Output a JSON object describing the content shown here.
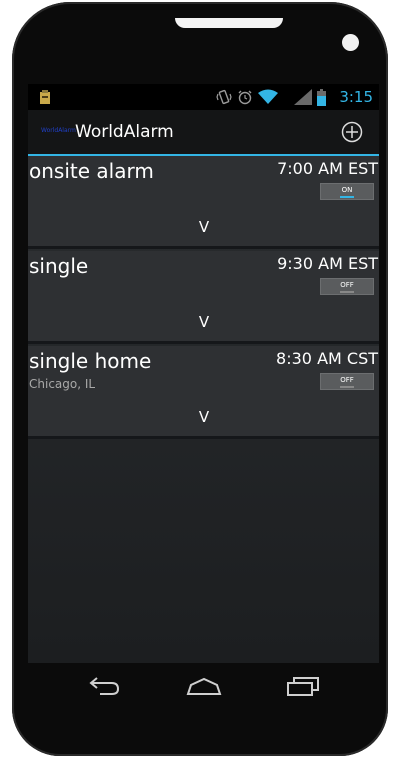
{
  "statusbar": {
    "time": "3:15",
    "icons": [
      "notification-icon",
      "vibrate-icon",
      "alarm-icon",
      "wifi-icon",
      "signal-icon",
      "battery-icon"
    ]
  },
  "actionbar": {
    "app_icon_text": "WorldAlarm",
    "title": "WorldAlarm",
    "add_icon": "plus-circle-icon"
  },
  "alarms": [
    {
      "name": "onsite alarm",
      "location": "",
      "time": "7:00 AM EST",
      "toggle": "ON",
      "expand": "V"
    },
    {
      "name": "single",
      "location": "",
      "time": "9:30 AM EST",
      "toggle": "OFF",
      "expand": "V"
    },
    {
      "name": "single home",
      "location": "Chicago, IL",
      "time": "8:30 AM CST",
      "toggle": "OFF",
      "expand": "V"
    }
  ],
  "navbar": [
    "back-icon",
    "home-icon",
    "recent-apps-icon"
  ],
  "colors": {
    "accent": "#33b5e5",
    "background": "#2b2e31",
    "card": "#2e3033"
  }
}
